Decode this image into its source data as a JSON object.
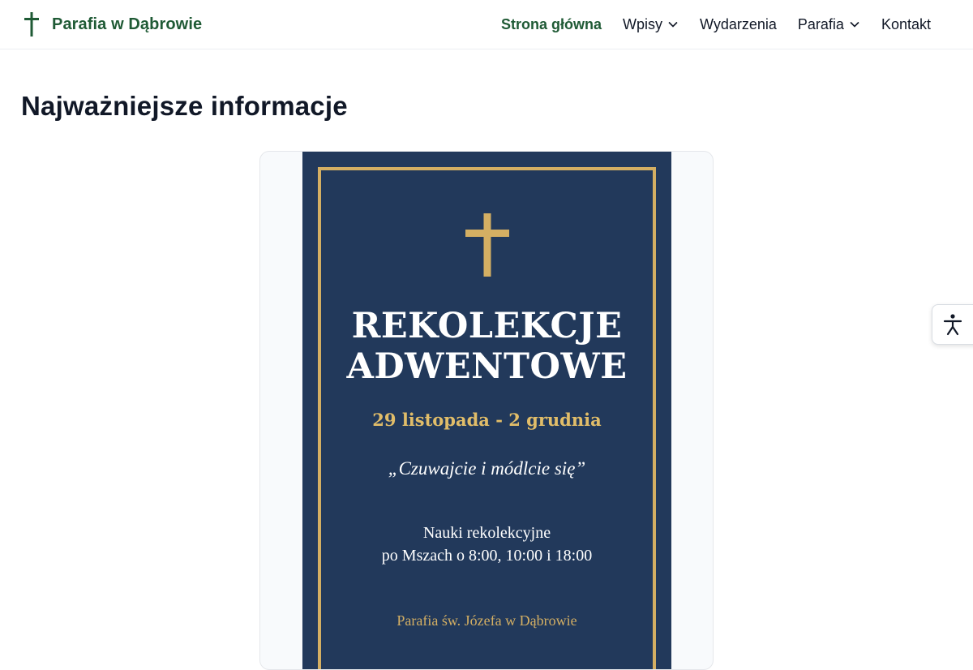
{
  "site": {
    "name": "Parafia w Dąbrowie",
    "logo_icon": "cross-icon",
    "brand_color": "#1f5a35"
  },
  "nav": {
    "items": [
      {
        "label": "Strona główna",
        "active": true,
        "has_dropdown": false
      },
      {
        "label": "Wpisy",
        "active": false,
        "has_dropdown": true
      },
      {
        "label": "Wydarzenia",
        "active": false,
        "has_dropdown": false
      },
      {
        "label": "Parafia",
        "active": false,
        "has_dropdown": true
      },
      {
        "label": "Kontakt",
        "active": false,
        "has_dropdown": false
      }
    ]
  },
  "main": {
    "title": "Najważniejsze informacje"
  },
  "poster": {
    "background_color": "#22395b",
    "accent_color": "#d4af63",
    "icon": "cross-icon",
    "title_line1": "REKOLEKCJE",
    "title_line2": "ADWENTOWE",
    "dates": "29 listopada - 2 grudnia",
    "quote": "„Czuwajcie i módlcie się”",
    "info_line1": "Nauki rekolekcyjne",
    "info_line2": "po Mszach o 8:00, 10:00 i 18:00",
    "parish": "Parafia św. Józefa w Dąbrowie"
  },
  "accessibility": {
    "icon": "accessibility-icon"
  }
}
